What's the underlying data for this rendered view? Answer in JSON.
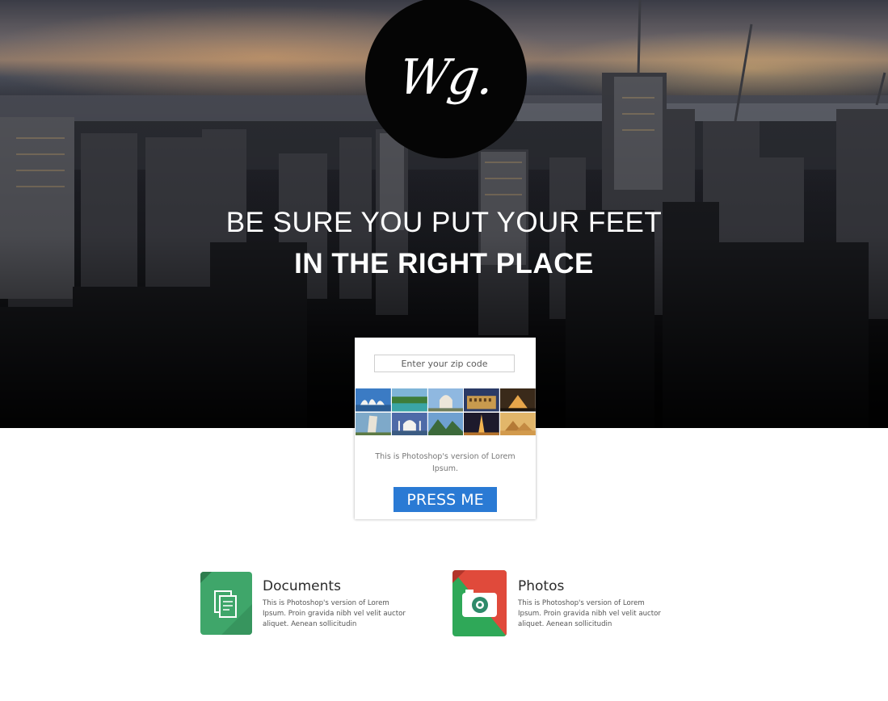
{
  "logo": {
    "text": "Wg."
  },
  "hero": {
    "headline_line1": "BE SURE YOU PUT YOUR FEET",
    "headline_line2": "IN THE RIGHT PLACE"
  },
  "card": {
    "zip_placeholder": "Enter your zip code",
    "zip_value": "",
    "description": "This is Photoshop's version of Lorem Ipsum.",
    "button_label": "PRESS ME",
    "thumbnails": [
      "sydney-opera-house-icon",
      "tropical-lake-icon",
      "sacre-coeur-icon",
      "colosseum-icon",
      "louvre-pyramid-icon",
      "leaning-tower-pisa-icon",
      "taj-mahal-icon",
      "mountain-valley-icon",
      "eiffel-tower-icon",
      "giza-pyramids-icon"
    ]
  },
  "features": [
    {
      "title": "Documents",
      "description": "This is Photoshop's version of Lorem Ipsum. Proin gravida nibh vel velit auctor aliquet. Aenean sollicitudin",
      "icon": "documents-icon",
      "color": "#3fa66a"
    },
    {
      "title": "Photos",
      "description": "This is Photoshop's version of Lorem Ipsum. Proin gravida nibh vel velit auctor aliquet. Aenean sollicitudin",
      "icon": "camera-icon",
      "color": "#e04a3b"
    }
  ],
  "colors": {
    "button": "#2a7ad4",
    "documents_green": "#3fa66a",
    "photos_red": "#e04a3b",
    "photos_green": "#2fa858"
  }
}
